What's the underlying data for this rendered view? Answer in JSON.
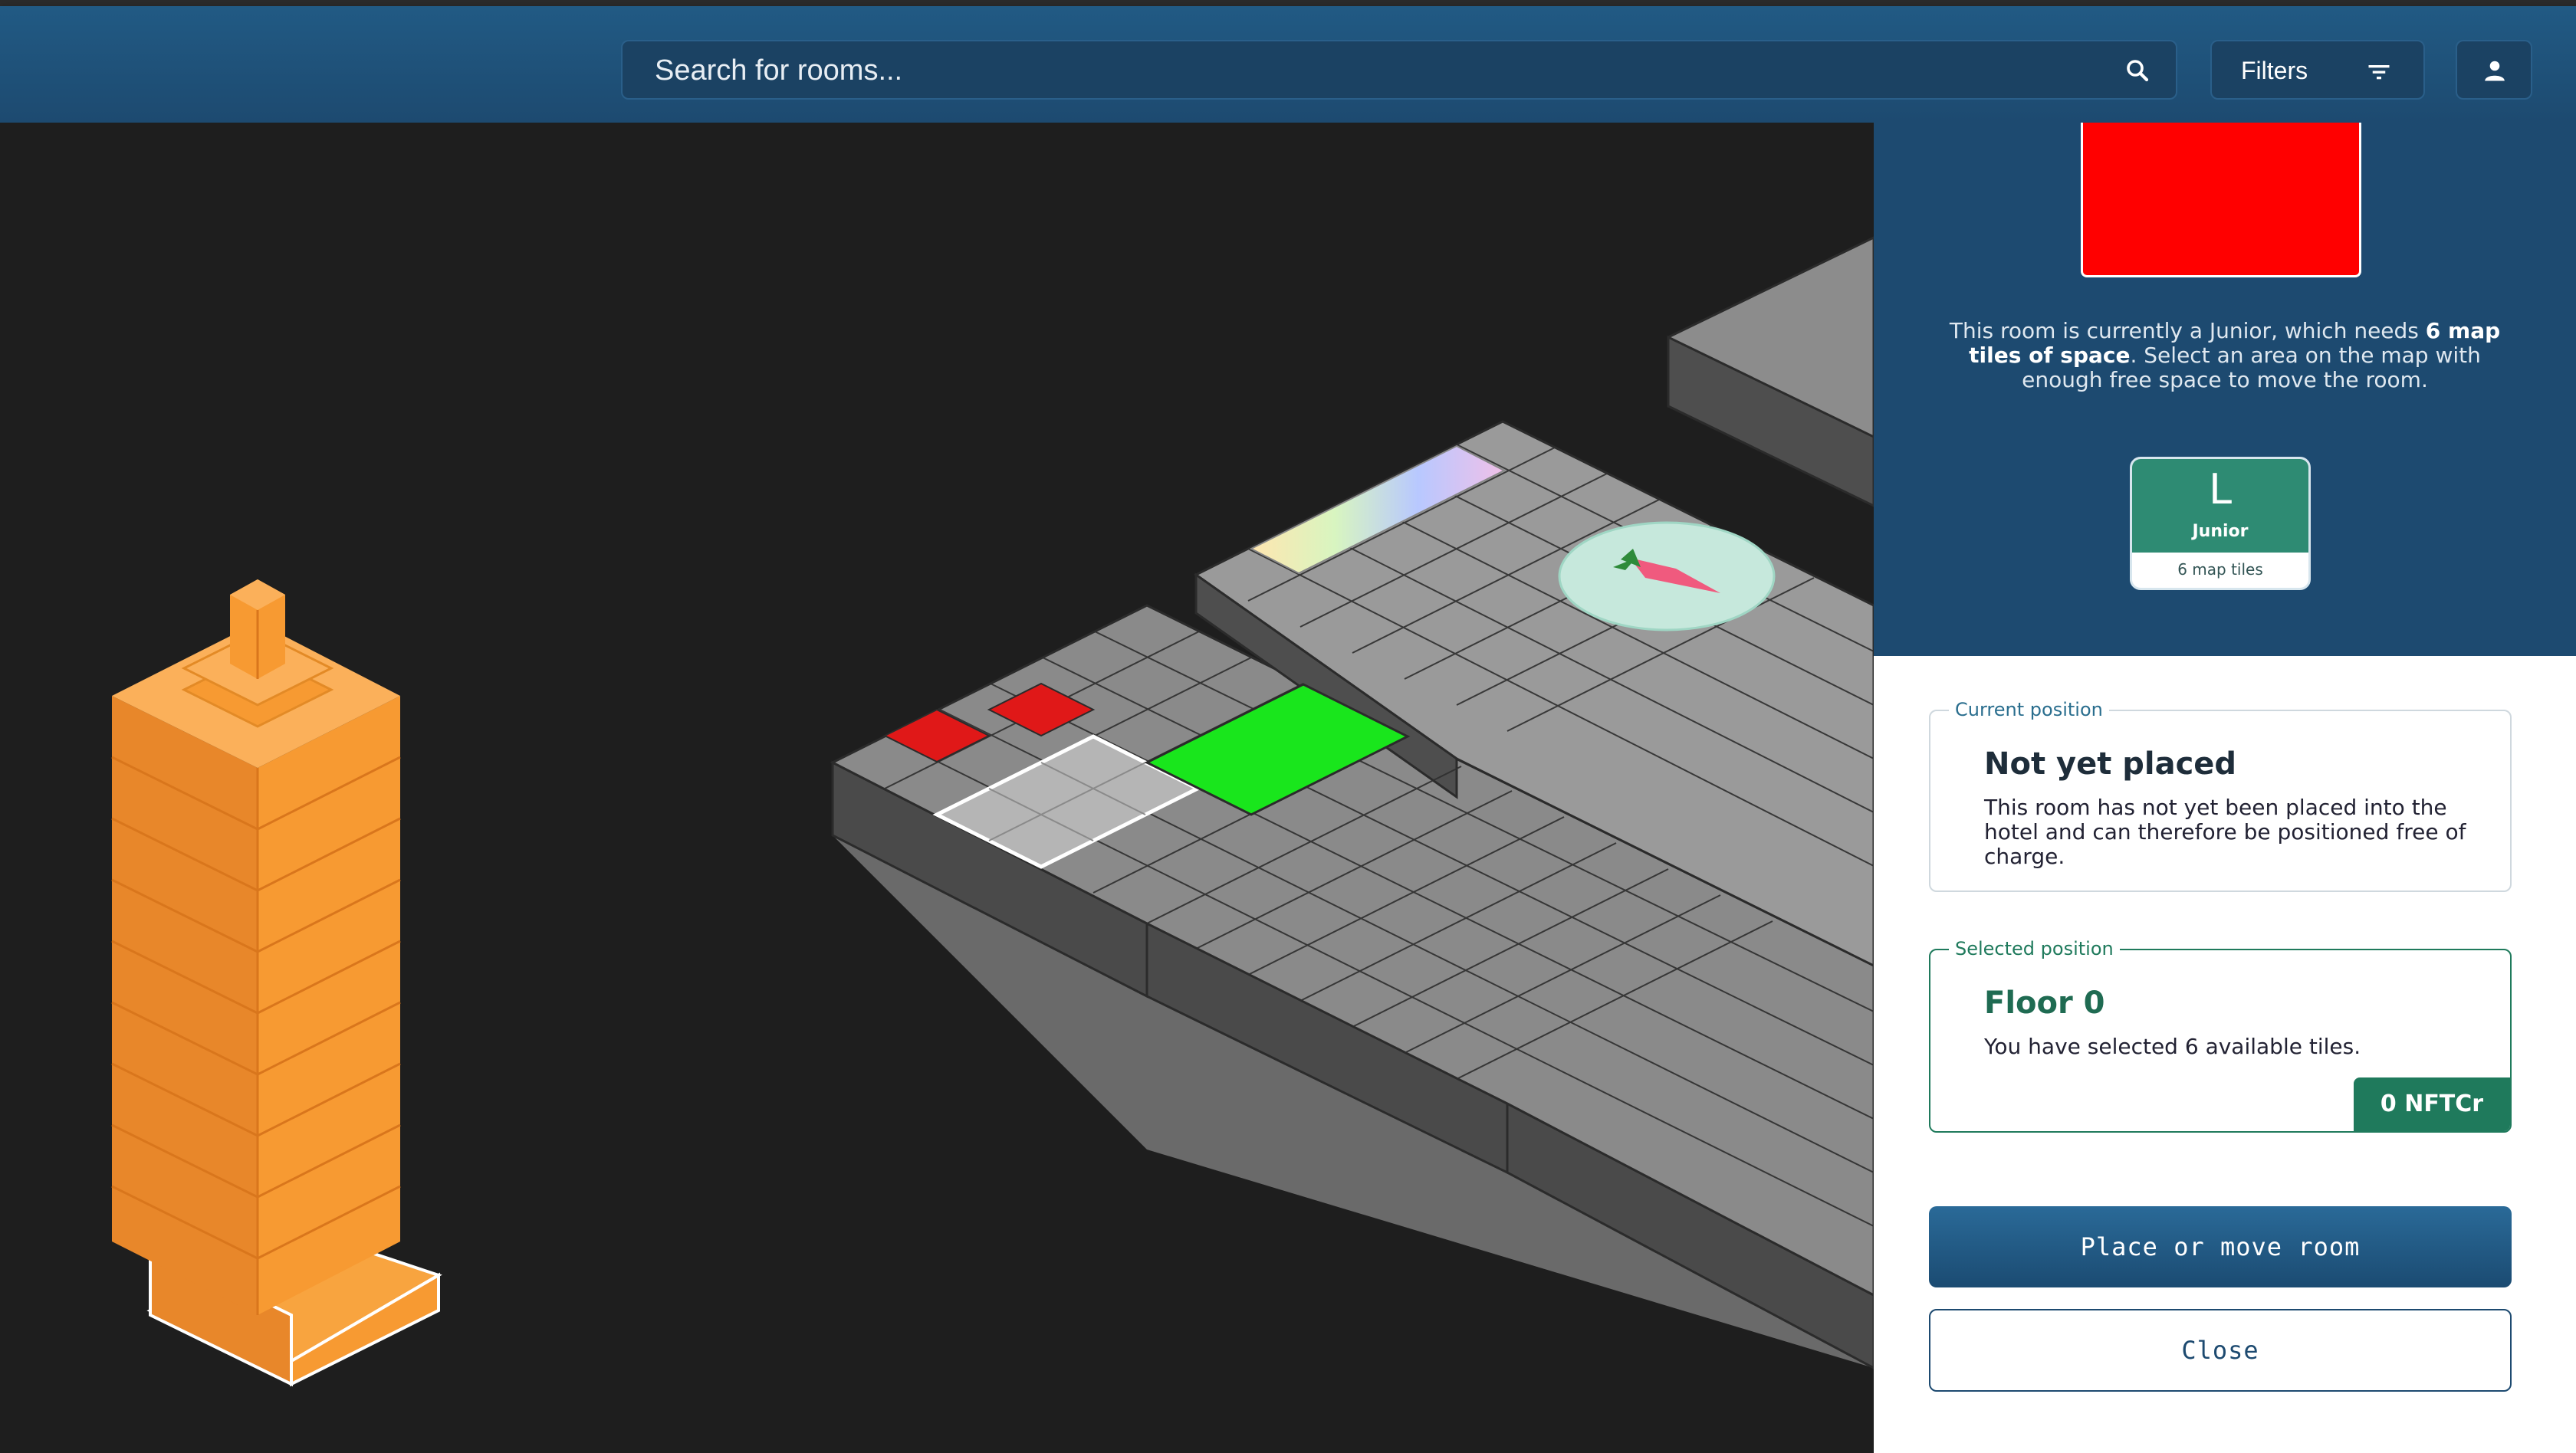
{
  "header": {
    "search_placeholder": "Search for rooms...",
    "filters_label": "Filters",
    "icons": [
      "search-icon",
      "filter-icon",
      "account-icon"
    ]
  },
  "colors": {
    "header": "#1d4a70",
    "accent_green": "#1f7a5c",
    "room_color": "#ff0000",
    "tower": "#f79a32",
    "floor_tile": "#8a8a8a",
    "selected_tile": "#19e61c"
  },
  "room": {
    "description_pre": "This room is currently a Junior, which needs ",
    "description_bold": "6 map tiles of space",
    "description_post": ". Select an area on the map with enough free space to move the room.",
    "size_letter": "L",
    "size_name": "Junior",
    "tiles_label": "6 map tiles"
  },
  "current_position": {
    "legend": "Current position",
    "title": "Not yet placed",
    "text": "This room has not yet been placed into the hotel and can therefore be positioned free of charge."
  },
  "selected_position": {
    "legend": "Selected position",
    "title": "Floor 0",
    "text": "You have selected 6 available tiles.",
    "price": "0 NFTCr"
  },
  "actions": {
    "primary": "Place or move room",
    "secondary": "Close"
  }
}
